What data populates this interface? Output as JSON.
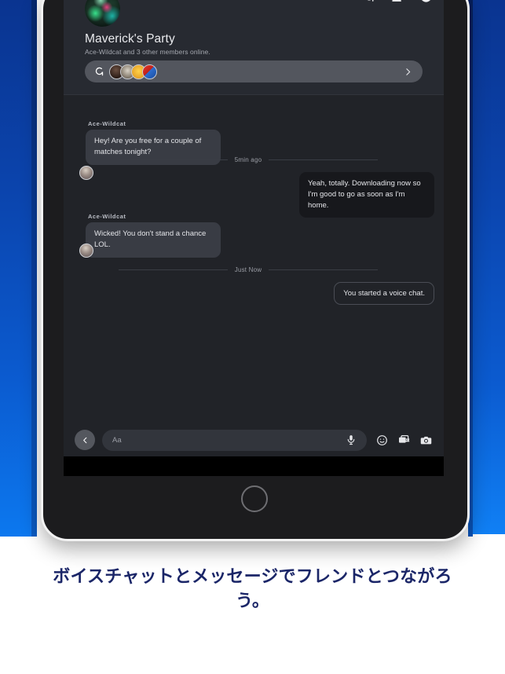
{
  "app": {
    "caption": "ボイスチャットとメッセージでフレンドとつながろう。"
  },
  "header": {
    "party_title": "Maverick's Party",
    "party_subtitle": "Ace-Wildcat and 3 other members online.",
    "avatar_name": "party-game-artwork",
    "icons": [
      {
        "name": "voice-chat-icon",
        "glyph": "voice"
      },
      {
        "name": "add-member-icon",
        "glyph": "person-plus"
      },
      {
        "name": "info-icon",
        "glyph": "info"
      }
    ],
    "party_bar": {
      "voice_icon": "voice-chat-icon",
      "member_count": 4,
      "chevron": "chevron-right-icon"
    }
  },
  "messages": [
    {
      "sender": "Ace-Wildcat",
      "text": "Hey! Are you free for a couple of matches tonight?",
      "side": "in"
    },
    {
      "divider": "5min ago"
    },
    {
      "sender": "",
      "text": "Yeah, totally. Downloading now so I'm good to go as soon as I'm home.",
      "side": "out"
    },
    {
      "sender": "Ace-Wildcat",
      "text": "Wicked! You don't stand a chance LOL.",
      "side": "in"
    },
    {
      "divider": "Just Now"
    },
    {
      "sender": "",
      "text": "You started a voice chat.",
      "side": "notice"
    }
  ],
  "msg": {
    "m1_sender": "Ace-Wildcat",
    "m1_text": "Hey! Are you free for a couple of matches tonight?",
    "d1": "5min ago",
    "m2_text": "Yeah, totally. Downloading now so I'm good to go as soon as I'm home.",
    "m3_sender": "Ace-Wildcat",
    "m3_text": "Wicked! You don't stand a chance LOL.",
    "d2": "Just Now",
    "m4_text": "You started a voice chat."
  },
  "composer": {
    "back_icon": "chevron-left-icon",
    "placeholder": "Aa",
    "icons": [
      {
        "name": "microphone-icon"
      },
      {
        "name": "emoji-icon"
      },
      {
        "name": "sticker-icon"
      },
      {
        "name": "camera-icon"
      }
    ]
  },
  "colors": {
    "screen_bg": "#212328",
    "header_bg": "#272a31",
    "bubble_in": "#393c44",
    "bubble_out": "#17181c",
    "party_bar": "#53565e",
    "accent_blue_dark": "#0a3490",
    "accent_blue_light": "#0c79f0",
    "caption_text": "#1b2668"
  }
}
